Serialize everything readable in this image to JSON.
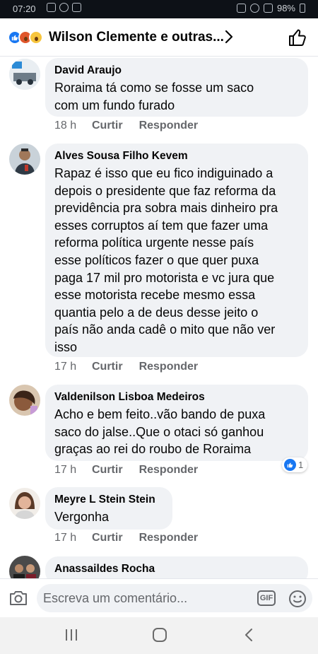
{
  "status_bar": {
    "time": "07:20",
    "battery": "98%"
  },
  "header": {
    "title": "Wilson Clemente e outras..."
  },
  "comments": [
    {
      "author": "David Araujo",
      "text": "Roraima tá como se fosse um saco\ncom um fundo furado",
      "time": "18 h",
      "like": "Curtir",
      "reply": "Responder"
    },
    {
      "author": "Alves Sousa Filho Kevem",
      "text": "Rapaz é  isso que eu fico indiguinado a\ndepois o presidente que faz reforma da\nprevidência pra sobra mais dinheiro  pra\nesses corruptos aí tem que fazer uma\nreforma política urgente nesse país\nesse políticos fazer o que quer puxa\npaga 17 mil pro motorista e  vc jura que\nesse motorista  recebe mesmo  essa\nquantia pelo a de deus desse jeito  o\npaís não  anda cadê o mito  que não ver\nisso",
      "time": "17 h",
      "like": "Curtir",
      "reply": "Responder"
    },
    {
      "author": "Valdenilson Lisboa Medeiros",
      "text": "Acho e bem feito..vão  bando de puxa\nsaco do jalse..Que o otaci  só ganhou\ngraças  ao rei do roubo de Roraima",
      "time": "17 h",
      "like": "Curtir",
      "reply": "Responder",
      "reaction_count": "1"
    },
    {
      "author": "Meyre L Stein Stein",
      "text": "Vergonha",
      "time": "17 h",
      "like": "Curtir",
      "reply": "Responder"
    },
    {
      "author": "Anassaildes Rocha",
      "text": ""
    }
  ],
  "composer": {
    "placeholder": "Escreva um comentário...",
    "gif_label": "GIF"
  },
  "colors": {
    "accent": "#1877f2",
    "bubble": "#f0f2f5",
    "meta": "#65676b"
  },
  "icons": [
    "camera-icon",
    "gif-icon",
    "emoji-icon",
    "thumbs-up-icon",
    "chevron-right-icon"
  ]
}
